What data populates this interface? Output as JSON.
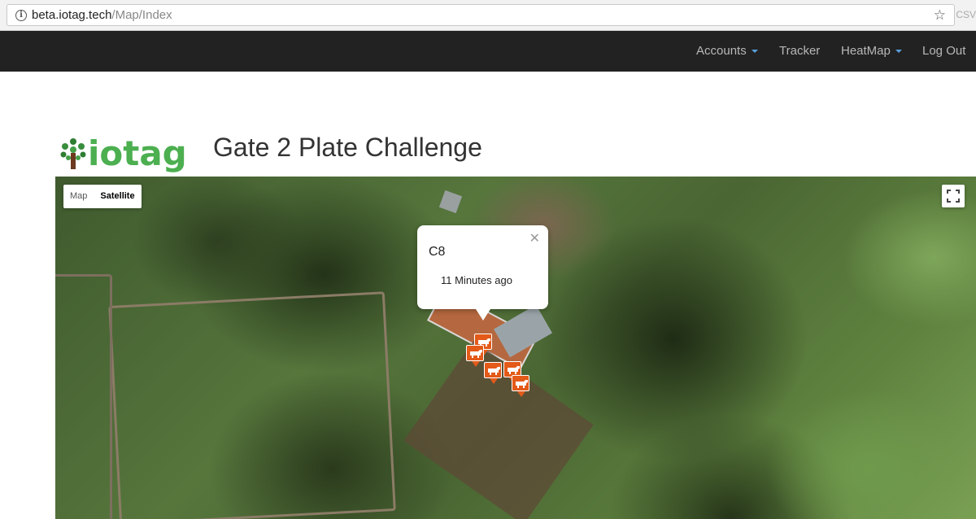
{
  "browser": {
    "url_host": "beta.iotag.tech",
    "url_path": "/Map/Index",
    "ext_label": "CSV"
  },
  "nav": {
    "items": [
      {
        "label": "Accounts",
        "dropdown": true
      },
      {
        "label": "Tracker",
        "dropdown": false
      },
      {
        "label": "HeatMap",
        "dropdown": true
      },
      {
        "label": "Log Out",
        "dropdown": false
      }
    ]
  },
  "brand": {
    "logo_text": "iotag",
    "logo_color": "#4caf50"
  },
  "page": {
    "title": "Gate 2 Plate Challenge"
  },
  "map": {
    "type_buttons": [
      "Map",
      "Satellite"
    ],
    "active_type": "Satellite",
    "popup": {
      "title": "C8",
      "time": "11 Minutes ago"
    },
    "marker_color": "#e35a19",
    "marker_icon": "cow-icon",
    "marker_count": 5
  },
  "colors": {
    "navbar": "#222222",
    "nav_text": "#b8b8b8",
    "caret": "#5aa0e0"
  }
}
